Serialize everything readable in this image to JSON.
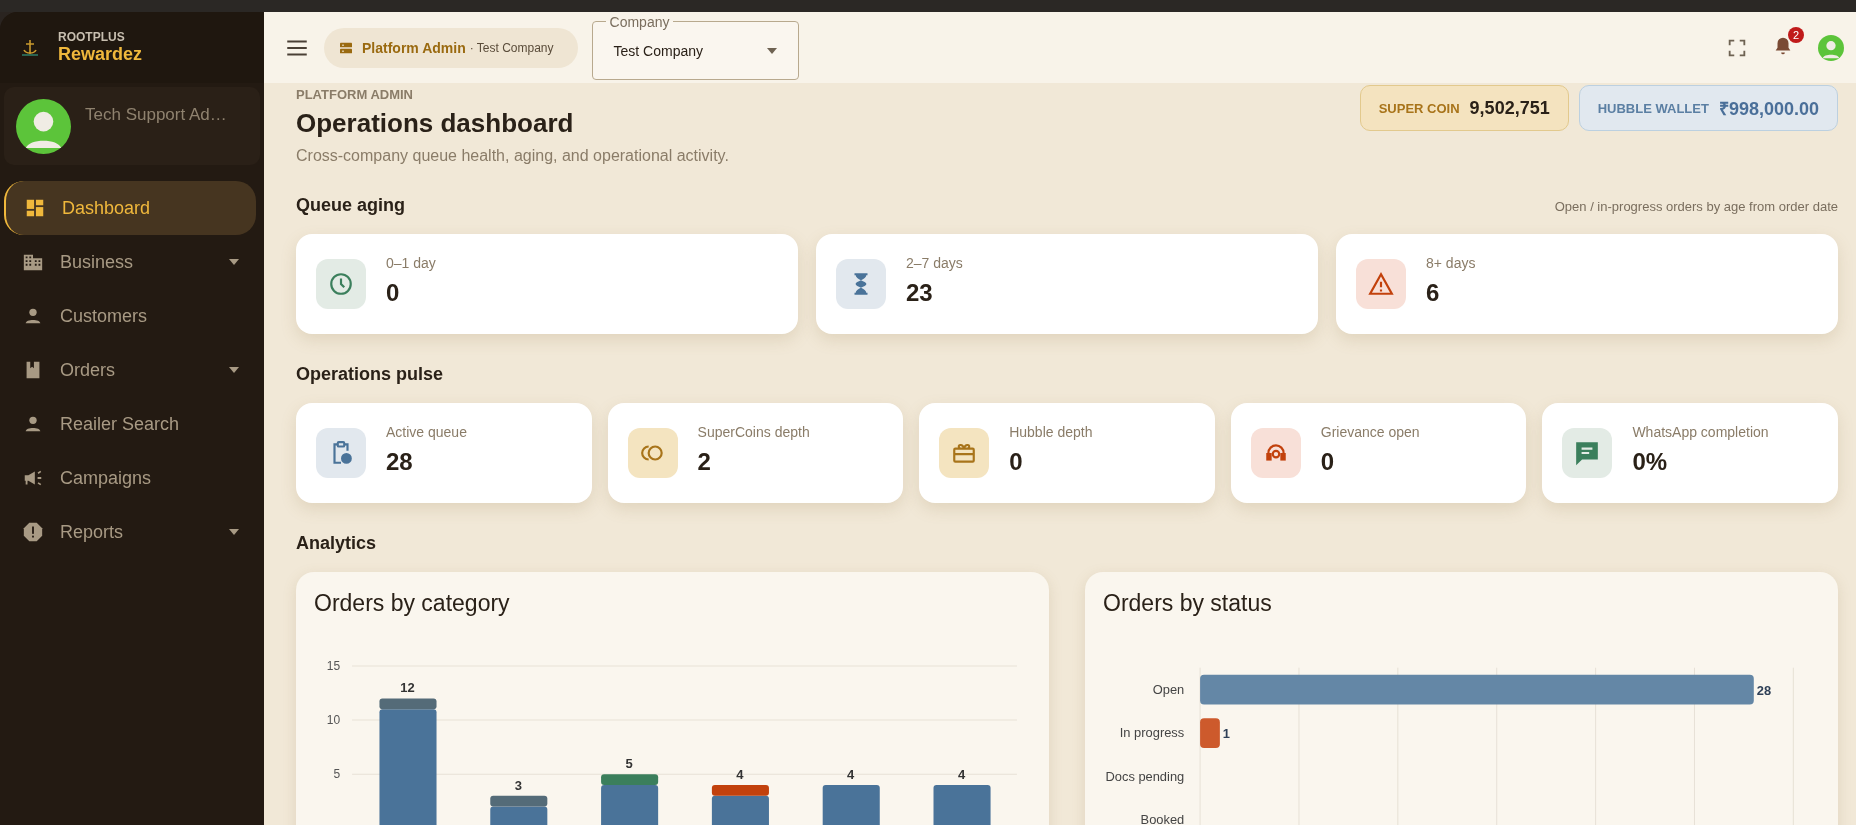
{
  "sidebar": {
    "brand_top": "ROOTPLUS",
    "brand_name": "Rewardez",
    "user_name": "Tech Support Ad…",
    "items": [
      {
        "label": "Dashboard",
        "kind": "dashboard",
        "selected": true,
        "expandable": false
      },
      {
        "label": "Business",
        "kind": "building",
        "selected": false,
        "expandable": true
      },
      {
        "label": "Customers",
        "kind": "person",
        "selected": false,
        "expandable": false
      },
      {
        "label": "Orders",
        "kind": "book",
        "selected": false,
        "expandable": true
      },
      {
        "label": "Reailer Search",
        "kind": "person",
        "selected": false,
        "expandable": false
      },
      {
        "label": "Campaigns",
        "kind": "megaphone",
        "selected": false,
        "expandable": false
      },
      {
        "label": "Reports",
        "kind": "alert",
        "selected": false,
        "expandable": true
      }
    ]
  },
  "header": {
    "context": "Platform Admin",
    "context_detail": "· Test Company",
    "company_select": {
      "label": "Company",
      "value": "Test Company"
    },
    "notifications_count": "2"
  },
  "page": {
    "eyebrow": "PLATFORM ADMIN",
    "title": "Operations dashboard",
    "subtitle": "Cross-company queue health, aging, and operational activity.",
    "wallets": [
      {
        "label": "SUPER COIN",
        "value": "9,502,751",
        "kind": "coin"
      },
      {
        "label": "HUBBLE WALLET",
        "value": "₹998,000.00",
        "kind": "wallet"
      }
    ]
  },
  "queue_aging": {
    "title": "Queue aging",
    "note": "Open / in-progress orders by age from order date",
    "cards": [
      {
        "label": "0–1 day",
        "value": "0",
        "kind": "clock"
      },
      {
        "label": "2–7 days",
        "value": "23",
        "kind": "hourglass"
      },
      {
        "label": "8+ days",
        "value": "6",
        "kind": "warning"
      }
    ]
  },
  "operations_pulse": {
    "title": "Operations pulse",
    "cards": [
      {
        "label": "Active queue",
        "value": "28",
        "kind": "clipboard"
      },
      {
        "label": "SuperCoins depth",
        "value": "2",
        "kind": "coins"
      },
      {
        "label": "Hubble depth",
        "value": "0",
        "kind": "gift"
      },
      {
        "label": "Grievance open",
        "value": "0",
        "kind": "headset"
      },
      {
        "label": "WhatsApp completion",
        "value": "0%",
        "kind": "chat"
      }
    ]
  },
  "analytics": {
    "title": "Analytics",
    "charts": [
      {
        "title": "Orders by category",
        "chart_data": {
          "type": "bar",
          "orientation": "vertical",
          "stacked": true,
          "value_labels": [
            "12",
            "3",
            "5",
            "4",
            "4",
            "4"
          ],
          "ylim": [
            0,
            15
          ],
          "yticks": [
            5,
            10,
            15
          ],
          "series": [
            {
              "color": "#4a7399",
              "values": [
                11,
                2,
                4,
                3,
                4,
                4
              ]
            },
            {
              "color": "#546b78",
              "values": [
                1,
                1,
                0,
                0,
                0,
                0
              ]
            },
            {
              "color": "#3b7f5c",
              "values": [
                0,
                0,
                1,
                0,
                0,
                0
              ]
            },
            {
              "color": "#c2410c",
              "values": [
                0,
                0,
                0,
                1,
                0,
                0
              ]
            }
          ]
        }
      },
      {
        "title": "Orders by status",
        "chart_data": {
          "type": "bar",
          "orientation": "horizontal",
          "stacked": true,
          "data_labels": true,
          "categories": [
            "Open",
            "In progress",
            "Docs pending",
            "Booked"
          ],
          "series": [
            {
              "color": "#6487a6",
              "values": [
                28,
                null,
                null,
                null
              ]
            },
            {
              "color": "#cd5a2c",
              "values": [
                null,
                1,
                null,
                null
              ]
            }
          ]
        }
      }
    ]
  }
}
